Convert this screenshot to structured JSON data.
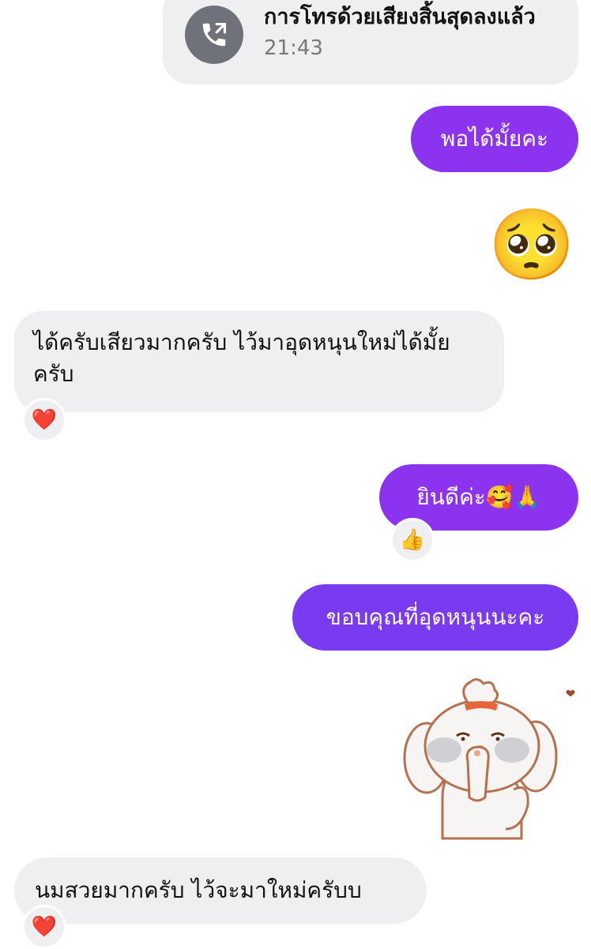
{
  "call_ended": {
    "title": "การโทรด้วยเสียงสิ้นสุดลงแล้ว",
    "time": "21:43"
  },
  "messages": {
    "m1": "พอได้มั้ยคะ",
    "m2_emoji": "🥺",
    "m3": "ได้ครับเสียวมากครับ ไว้มาอุดหนุนใหม่ได้มั้ยครับ",
    "m3_reaction": "❤️",
    "m4": "ยินดีค่ะ🥰🙏",
    "m4_reaction": "👍",
    "m5": "ขอบคุณที่อุดหนุนนะคะ",
    "m6": "นมสวยมากครับ ไว้จะมาใหม่ครับบ",
    "m6_reaction": "❤️"
  },
  "colors": {
    "outgoing_purple": "#8b33ee",
    "outgoing_blue_purple": "#7a3af0",
    "incoming_gray": "#efeff2"
  }
}
